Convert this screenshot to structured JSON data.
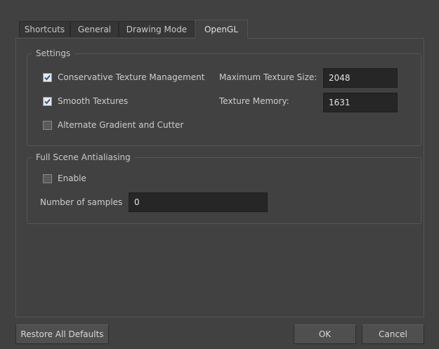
{
  "tabs": [
    {
      "label": "Shortcuts"
    },
    {
      "label": "General"
    },
    {
      "label": "Drawing Mode"
    },
    {
      "label": "OpenGL"
    }
  ],
  "active_tab": "OpenGL",
  "settings": {
    "title": "Settings",
    "conservative_texture_management": {
      "label": "Conservative Texture Management",
      "checked": true
    },
    "smooth_textures": {
      "label": "Smooth Textures",
      "checked": true
    },
    "alternate_gradient": {
      "label": "Alternate Gradient and Cutter",
      "checked": false
    },
    "max_texture_size": {
      "label": "Maximum Texture Size:",
      "value": "2048"
    },
    "texture_memory": {
      "label": "Texture Memory:",
      "value": "1631"
    }
  },
  "antialiasing": {
    "title": "Full Scene Antialiasing",
    "enable": {
      "label": "Enable",
      "checked": false
    },
    "samples": {
      "label": "Number of samples",
      "value": "0"
    }
  },
  "buttons": {
    "restore": "Restore All Defaults",
    "ok": "OK",
    "cancel": "Cancel"
  }
}
